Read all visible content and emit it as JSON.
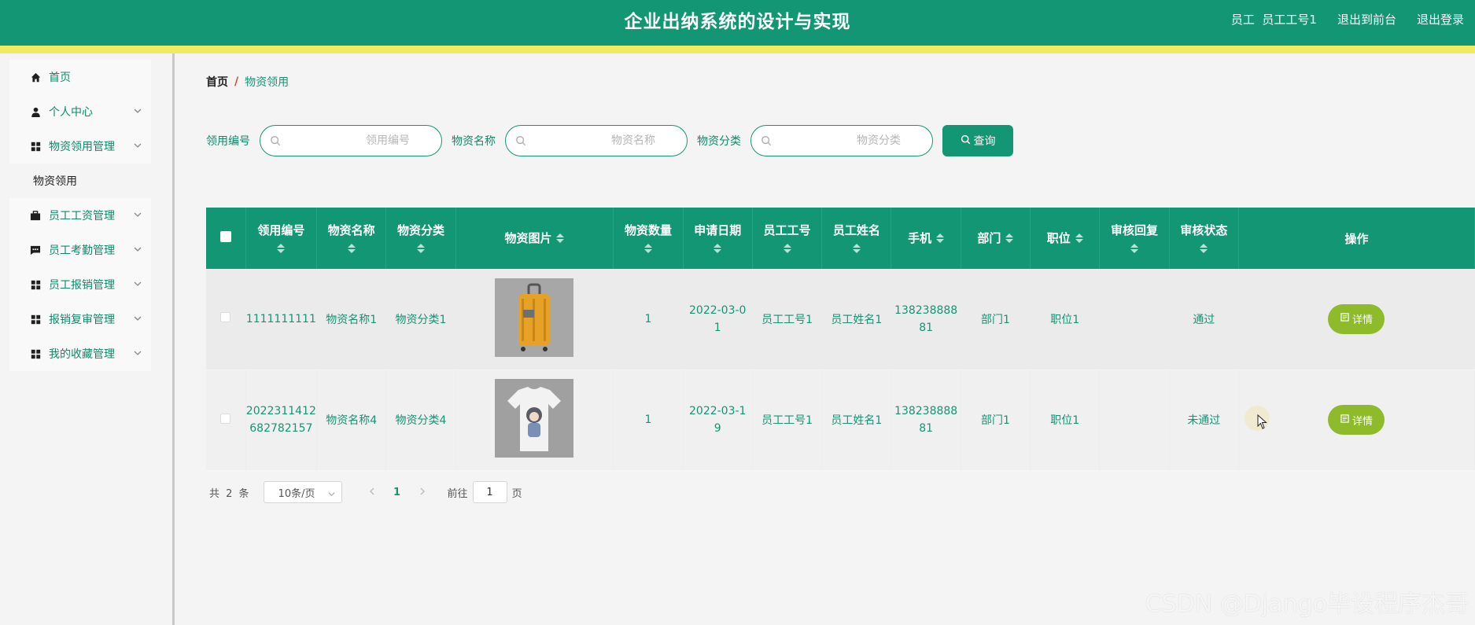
{
  "header": {
    "title": "企业出纳系统的设计与实现",
    "user_role": "员工",
    "user_name": "员工工号1",
    "front_link": "退出到前台",
    "logout_link": "退出登录"
  },
  "sidebar": {
    "items": [
      {
        "label": "首页",
        "icon": "home-icon"
      },
      {
        "label": "个人中心",
        "icon": "user-icon"
      },
      {
        "label": "物资领用管理",
        "icon": "grid-icon"
      },
      {
        "label": "物资领用",
        "icon": ""
      },
      {
        "label": "员工工资管理",
        "icon": "briefcase-icon"
      },
      {
        "label": "员工考勤管理",
        "icon": "chat-icon"
      },
      {
        "label": "员工报销管理",
        "icon": "grid-icon"
      },
      {
        "label": "报销复审管理",
        "icon": "grid-icon"
      },
      {
        "label": "我的收藏管理",
        "icon": "grid-icon"
      }
    ]
  },
  "breadcrumb": {
    "home": "首页",
    "separator": "/",
    "current": "物资领用"
  },
  "search": {
    "fields": [
      {
        "label": "领用编号",
        "placeholder": "领用编号",
        "value": ""
      },
      {
        "label": "物资名称",
        "placeholder": "物资名称",
        "value": ""
      },
      {
        "label": "物资分类",
        "placeholder": "物资分类",
        "value": ""
      }
    ],
    "button": "查询"
  },
  "table": {
    "columns": [
      "领用编号",
      "物资名称",
      "物资分类",
      "物资图片",
      "物资数量",
      "申请日期",
      "员工工号",
      "员工姓名",
      "手机",
      "部门",
      "职位",
      "审核回复",
      "审核状态",
      "操作"
    ],
    "rows": [
      {
        "code_1": "1111111111",
        "code_2": "",
        "name": "物资名称1",
        "category": "物资分类1",
        "image": "suitcase-image",
        "qty": "1",
        "date_1": "2022-03-0",
        "date_2": "1",
        "emp_no": "员工工号1",
        "emp_name": "员工姓名1",
        "phone_1": "138238888",
        "phone_2": "81",
        "dept": "部门1",
        "position": "职位1",
        "reply": "",
        "status": "通过",
        "action": "详情"
      },
      {
        "code_1": "2022311412",
        "code_2": "682782157",
        "name": "物资名称4",
        "category": "物资分类4",
        "image": "tshirt-image",
        "qty": "1",
        "date_1": "2022-03-1",
        "date_2": "9",
        "emp_no": "员工工号1",
        "emp_name": "员工姓名1",
        "phone_1": "138238888",
        "phone_2": "81",
        "dept": "部门1",
        "position": "职位1",
        "reply": "",
        "status": "未通过",
        "action": "详情"
      }
    ]
  },
  "pagination": {
    "total_text": "共 2 条",
    "page_size": "10条/页",
    "current_page": "1",
    "goto_label": "前往",
    "goto_value": "1",
    "page_unit": "页"
  },
  "watermark": "CSDN @Django毕设程序杰哥",
  "colors": {
    "primary": "#129674",
    "stripe": "#f2ea5f",
    "detail_button": "#8ebb2a",
    "breadcrumb_sep": "#e0442a"
  }
}
